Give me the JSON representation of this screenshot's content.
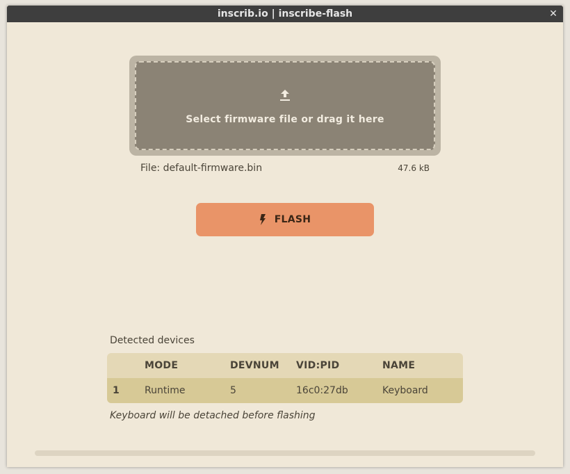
{
  "window": {
    "title": "inscrib.io | inscribe-flash",
    "close_glyph": "✕"
  },
  "dropzone": {
    "label": "Select firmware file or drag it here",
    "icon": "upload-icon"
  },
  "file": {
    "name_text": "File: default-firmware.bin",
    "size": "47.6 kB"
  },
  "flash_button": {
    "label": "FLASH",
    "icon": "lightning-bolt-icon"
  },
  "devices": {
    "title": "Detected devices",
    "columns": [
      "",
      "MODE",
      "DEVNUM",
      "VID:PID",
      "NAME"
    ],
    "rows": [
      [
        "1",
        "Runtime",
        "5",
        "16c0:27db",
        "Keyboard"
      ]
    ],
    "note": "Keyboard will be detached before flashing"
  },
  "progress": {
    "value": 0
  },
  "colors": {
    "background": "#f0e8d8",
    "titlebar": "#3e3e3e",
    "dropzone": "#8b8375",
    "accent": "#e99468",
    "table_header": "#e4d8b6",
    "table_row": "#d7c996"
  }
}
